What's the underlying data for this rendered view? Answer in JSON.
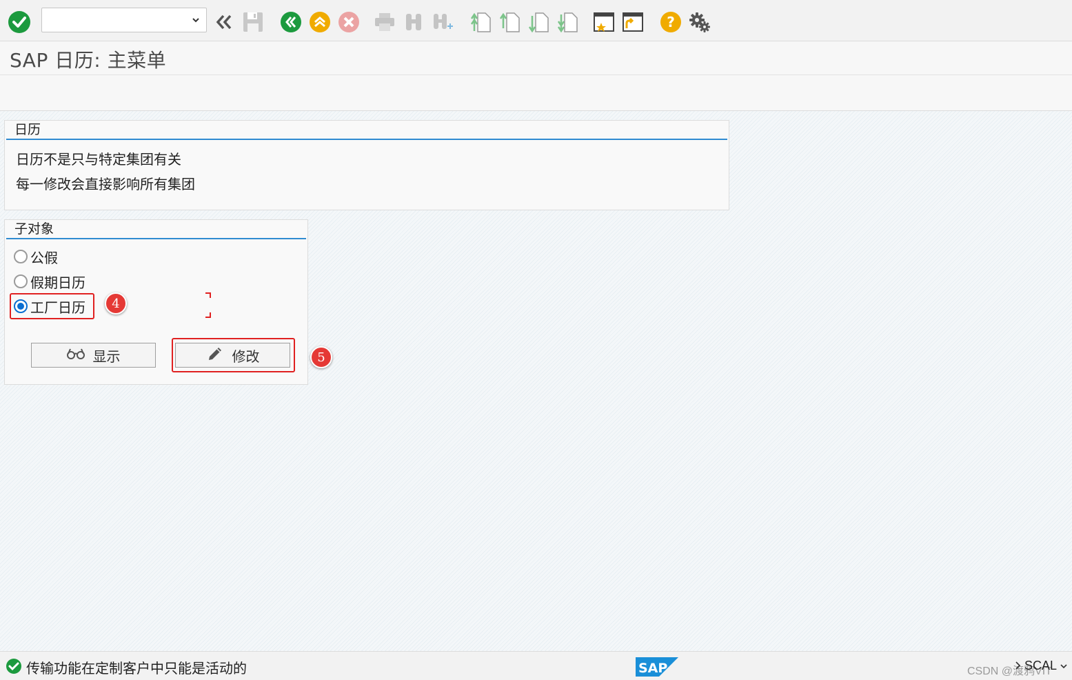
{
  "toolbar": {
    "command_field": {
      "value": "",
      "placeholder": ""
    },
    "icons": [
      "enter-icon",
      "back-icon",
      "save-icon",
      "exit-icon",
      "up-icon",
      "cancel-icon",
      "print-icon",
      "find-icon",
      "find-next-icon",
      "first-page-icon",
      "previous-page-icon",
      "next-page-icon",
      "last-page-icon",
      "new-session-icon",
      "shortcut-icon",
      "help-icon",
      "settings-icon"
    ]
  },
  "title": "SAP 日历: 主菜单",
  "calendar_group": {
    "title": "日历",
    "lines": [
      "日历不是只与特定集团有关",
      "每一修改会直接影响所有集团"
    ]
  },
  "subobject_group": {
    "title": "子对象",
    "options": [
      {
        "label": "公假",
        "checked": false
      },
      {
        "label": "假期日历",
        "checked": false
      },
      {
        "label": "工厂日历",
        "checked": true
      }
    ]
  },
  "buttons": {
    "display": "显示",
    "change": "修改"
  },
  "annotations": {
    "step4": "4",
    "step5": "5"
  },
  "status": {
    "message": "传输功能在定制客户中只能是活动的",
    "system": "SCAL",
    "watermark": "CSDN @渡鸦VIT"
  },
  "colors": {
    "accent": "#2f8bd1",
    "success": "#1c9a3e",
    "callout": "#e53935",
    "sap_blue": "#0a6ed1"
  }
}
